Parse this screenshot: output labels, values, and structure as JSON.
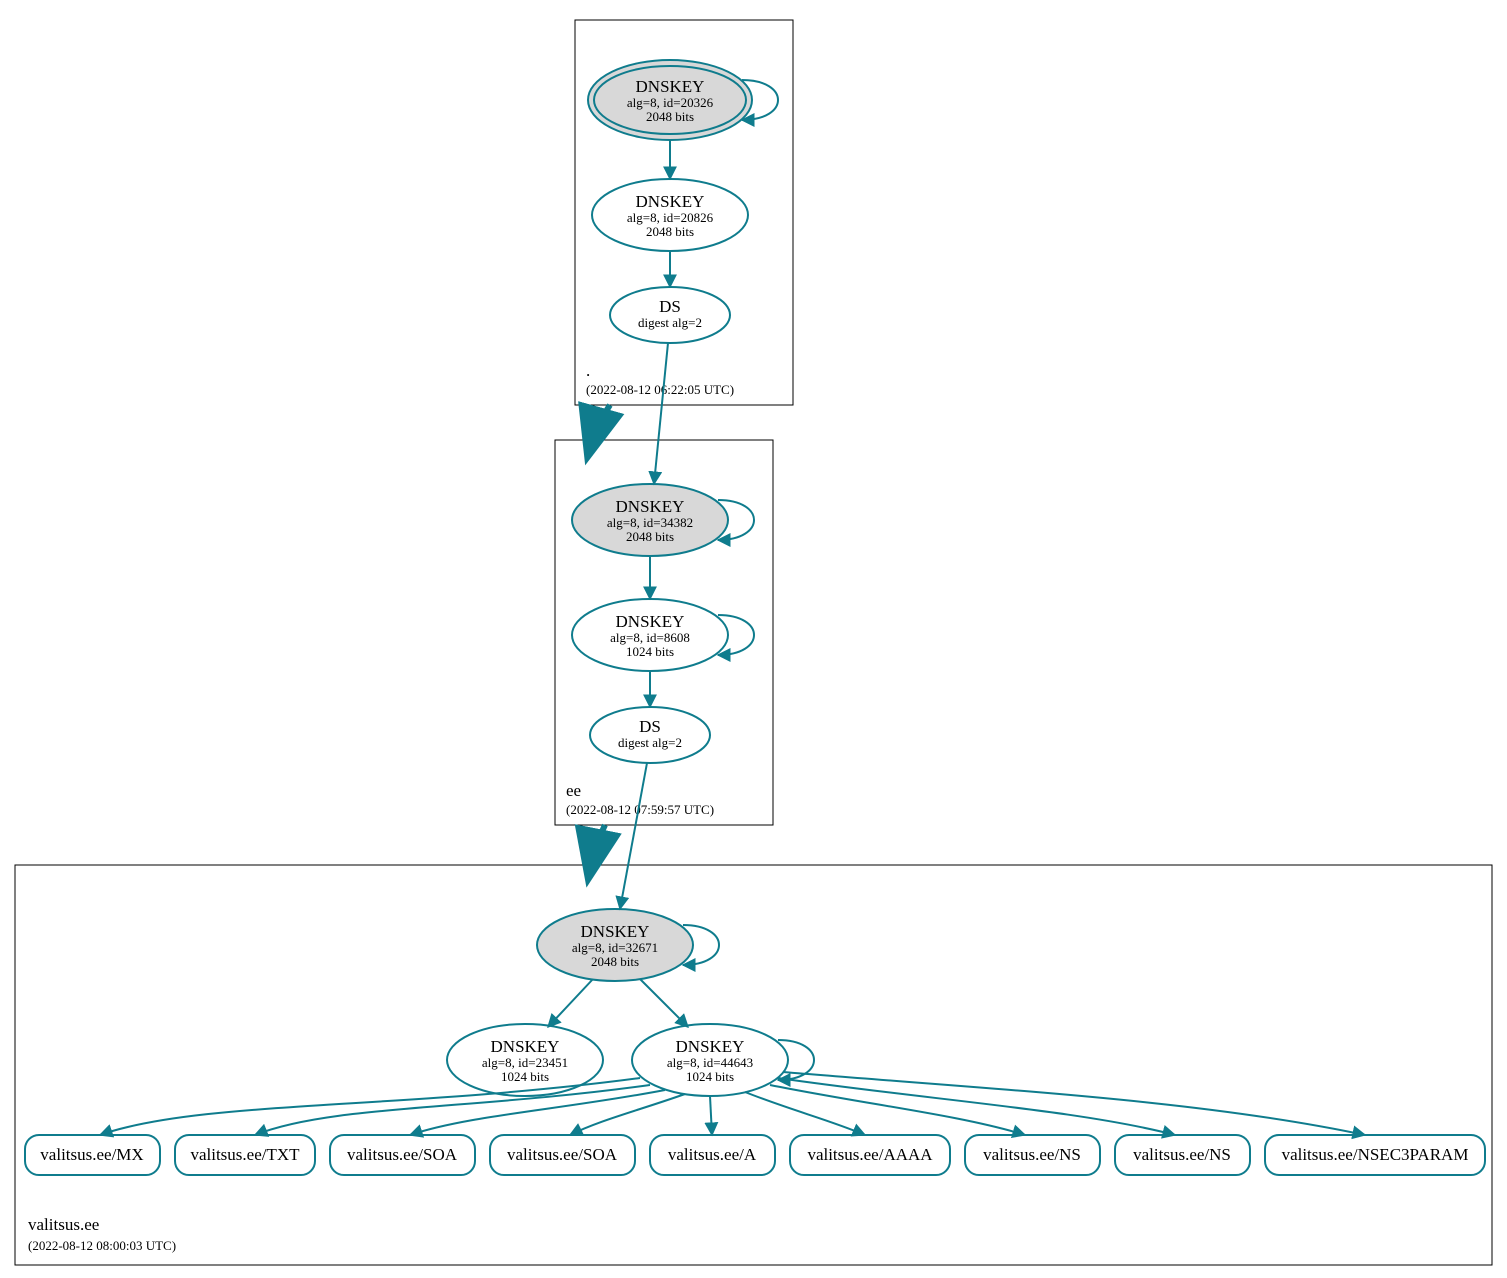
{
  "stroke": "#0f7c8d",
  "fill_grey": "#d8d8d8",
  "zones": {
    "root": {
      "name": ".",
      "timestamp": "(2022-08-12 06:22:05 UTC)"
    },
    "ee": {
      "name": "ee",
      "timestamp": "(2022-08-12 07:59:57 UTC)"
    },
    "val": {
      "name": "valitsus.ee",
      "timestamp": "(2022-08-12 08:00:03 UTC)"
    }
  },
  "nodes": {
    "root_ksk": {
      "title": "DNSKEY",
      "l2": "alg=8, id=20326",
      "l3": "2048 bits"
    },
    "root_zsk": {
      "title": "DNSKEY",
      "l2": "alg=8, id=20826",
      "l3": "2048 bits"
    },
    "root_ds": {
      "title": "DS",
      "l2": "digest alg=2"
    },
    "ee_ksk": {
      "title": "DNSKEY",
      "l2": "alg=8, id=34382",
      "l3": "2048 bits"
    },
    "ee_zsk": {
      "title": "DNSKEY",
      "l2": "alg=8, id=8608",
      "l3": "1024 bits"
    },
    "ee_ds": {
      "title": "DS",
      "l2": "digest alg=2"
    },
    "val_ksk": {
      "title": "DNSKEY",
      "l2": "alg=8, id=32671",
      "l3": "2048 bits"
    },
    "val_zsk1": {
      "title": "DNSKEY",
      "l2": "alg=8, id=23451",
      "l3": "1024 bits"
    },
    "val_zsk2": {
      "title": "DNSKEY",
      "l2": "alg=8, id=44643",
      "l3": "1024 bits"
    }
  },
  "rrsets": {
    "mx": "valitsus.ee/MX",
    "txt": "valitsus.ee/TXT",
    "soa1": "valitsus.ee/SOA",
    "soa2": "valitsus.ee/SOA",
    "a": "valitsus.ee/A",
    "aaaa": "valitsus.ee/AAAA",
    "ns1": "valitsus.ee/NS",
    "ns2": "valitsus.ee/NS",
    "nsec3": "valitsus.ee/NSEC3PARAM"
  }
}
